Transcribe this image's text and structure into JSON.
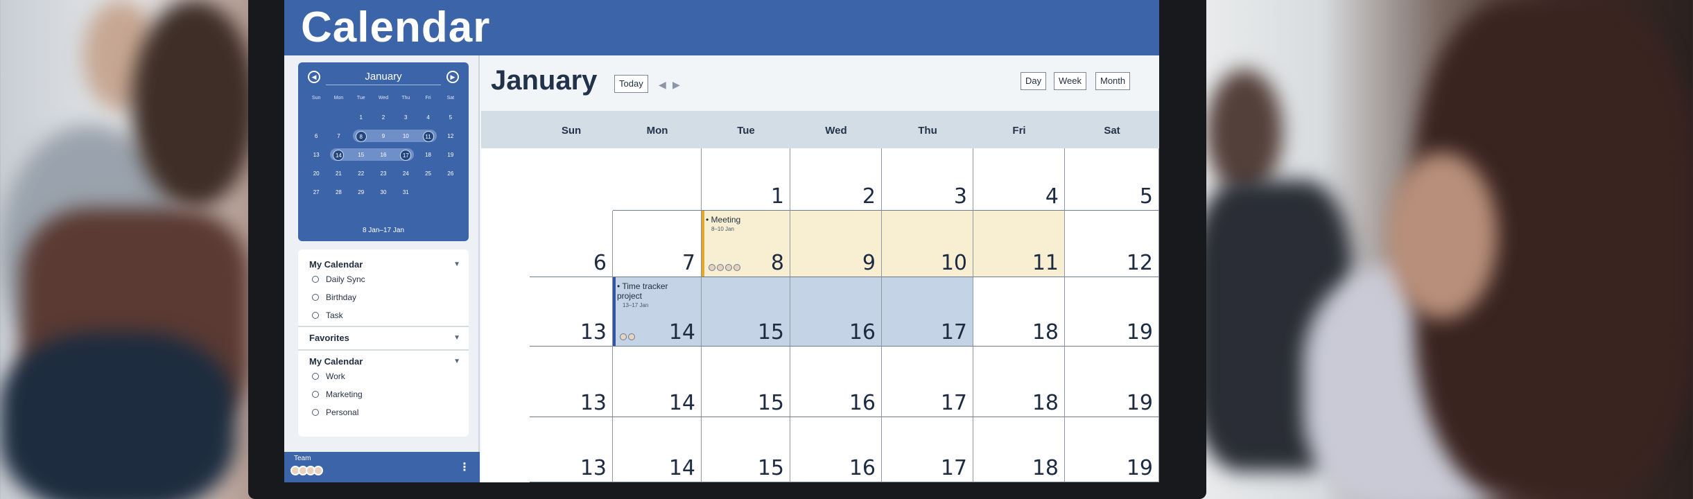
{
  "app": {
    "title": "Calendar"
  },
  "mini_calendar": {
    "month": "January",
    "prev_icon": "chevron-left-icon",
    "next_icon": "chevron-right-icon",
    "weekdays": [
      "Sun",
      "Mon",
      "Tue",
      "Wed",
      "Thu",
      "Fri",
      "Sat"
    ],
    "weeks": [
      [
        "",
        "",
        "1",
        "2",
        "3",
        "4",
        "5"
      ],
      [
        "6",
        "7",
        "8",
        "9",
        "10",
        "11",
        "12"
      ],
      [
        "13",
        "14",
        "15",
        "16",
        "17",
        "18",
        "19"
      ],
      [
        "20",
        "21",
        "22",
        "23",
        "24",
        "25",
        "26"
      ],
      [
        "27",
        "28",
        "29",
        "30",
        "31",
        "",
        ""
      ]
    ],
    "range_label": "8 Jan–17 Jan"
  },
  "sidebar": {
    "my_calendar_1": {
      "title": "My Calendar",
      "items": [
        "Daily Sync",
        "Birthday",
        "Task"
      ]
    },
    "favorites": {
      "title": "Favorites"
    },
    "my_calendar_2": {
      "title": "My Calendar",
      "items": [
        "Work",
        "Marketing",
        "Personal"
      ]
    },
    "team": {
      "label": "Team",
      "more_icon": "kebab-menu-icon"
    }
  },
  "main": {
    "month_title": "January",
    "today_label": "Today",
    "view_buttons": [
      "Day",
      "Week",
      "Month"
    ],
    "weekdays": [
      "Sun",
      "Mon",
      "Tue",
      "Wed",
      "Thu",
      "Fri",
      "Sat"
    ],
    "weeks": [
      [
        "",
        "1",
        "2",
        "3",
        "4",
        "5"
      ],
      [
        "6",
        "7",
        "8",
        "9",
        "10",
        "11",
        "12"
      ],
      [
        "13",
        "14",
        "15",
        "16",
        "17",
        "18",
        "19"
      ],
      [
        "13",
        "14",
        "15",
        "16",
        "17",
        "18",
        "19"
      ],
      [
        "13",
        "14",
        "15",
        "16",
        "17",
        "18",
        "19"
      ]
    ],
    "events": {
      "meeting": {
        "title": "• Meeting",
        "range": "8–10 Jan"
      },
      "tracker": {
        "title": "• Time tracker project",
        "range": "13–17 Jan"
      }
    }
  },
  "colors": {
    "brand": "#3c64a9",
    "event_yellow": "#f8efd3",
    "event_blue": "#c5d3e6"
  }
}
